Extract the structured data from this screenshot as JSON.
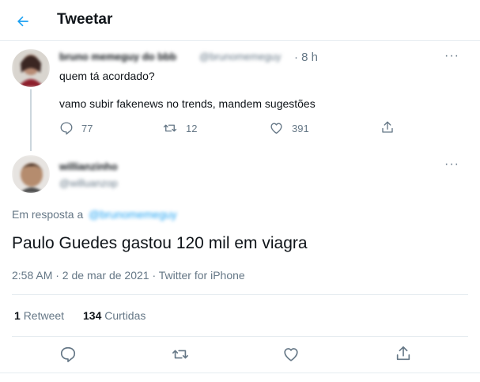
{
  "header": {
    "title": "Tweetar"
  },
  "parent_tweet": {
    "display_name": "bruno memeguy do bbb",
    "handle": "@brunomemeguy",
    "time": "· 8 h",
    "text_line1": "quem tá acordado?",
    "text_line2": "vamo subir fakenews no trends, mandem sugestões",
    "replies": "77",
    "retweets": "12",
    "likes": "391",
    "more": "···"
  },
  "main_tweet": {
    "display_name": "willianzinho",
    "handle": "@willuanzop",
    "more": "···",
    "reply_prefix": "Em resposta a",
    "reply_to": "@brunomemeguy",
    "text": "Paulo Guedes gastou 120 mil em viagra",
    "timestamp": "2:58 AM · 2 de mar de 2021 · Twitter for iPhone",
    "retweet_count": "1",
    "retweet_label": "Retweet",
    "like_count": "134",
    "like_label": "Curtidas"
  },
  "colors": {
    "accent": "#1da1f2",
    "muted": "#657786",
    "border": "#e6ecf0"
  },
  "icons": [
    "back-arrow-icon",
    "reply-icon",
    "retweet-icon",
    "like-icon",
    "share-icon",
    "more-icon"
  ]
}
